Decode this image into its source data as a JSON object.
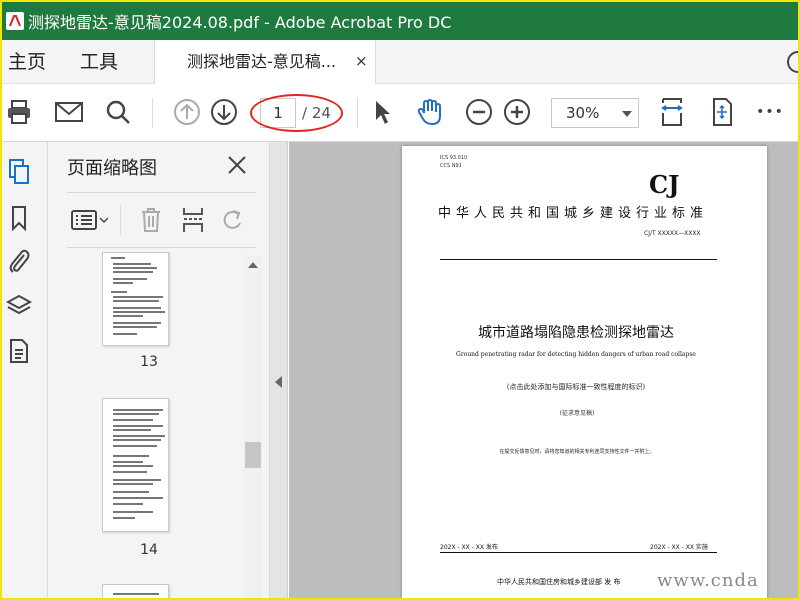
{
  "window": {
    "title": "测探地雷达-意见稿2024.08.pdf - Adobe Acrobat Pro DC"
  },
  "menu_tabs": {
    "home": "主页",
    "tools": "工具"
  },
  "document_tab": {
    "label": "测探地雷达-意见稿...",
    "close_glyph": "×"
  },
  "toolbar": {
    "current_page": "1",
    "total_pages": "/ 24",
    "zoom": "30%",
    "more_glyph": "•••"
  },
  "colors": {
    "titlebar": "#1f7a3f",
    "accent_blue": "#1f6fc9",
    "annotation_red": "#e0261f"
  },
  "icons": [
    "print-icon",
    "mail-icon",
    "search-icon",
    "page-up-icon",
    "page-down-icon",
    "pointer-icon",
    "hand-icon",
    "zoom-out-icon",
    "zoom-in-icon",
    "fit-page-icon",
    "rotate-view-icon",
    "more-icon"
  ],
  "panel": {
    "title": "页面缩略图",
    "thumbnails": [
      {
        "page": "13"
      },
      {
        "page": "14"
      }
    ]
  },
  "document_page": {
    "ics": "ICS  93.010",
    "ccs": "CCS  N91",
    "cj": "CJ",
    "standard_name": "中华人民共和国城乡建设行业标准",
    "code": "CJ/T XXXXX—XXXX",
    "title": "城市道路塌陷隐患检测探地雷达",
    "english_title": "Ground penetrating radar for detecting hidden dangers of urban road collapse",
    "consistency_note": "(点击此处添加与国际标准一致性程度的标识)",
    "draft_label": "(征求意见稿)",
    "request_note": "在提交反馈意见时，请将您知道的相关专利连同支持性文件一并附上。",
    "publish_date": "202X - XX - XX 发布",
    "implement_date": "202X - XX - XX 实施",
    "issuer": "中华人民共和国住房和城乡建设部    发  布"
  },
  "watermark": "www.cnda"
}
